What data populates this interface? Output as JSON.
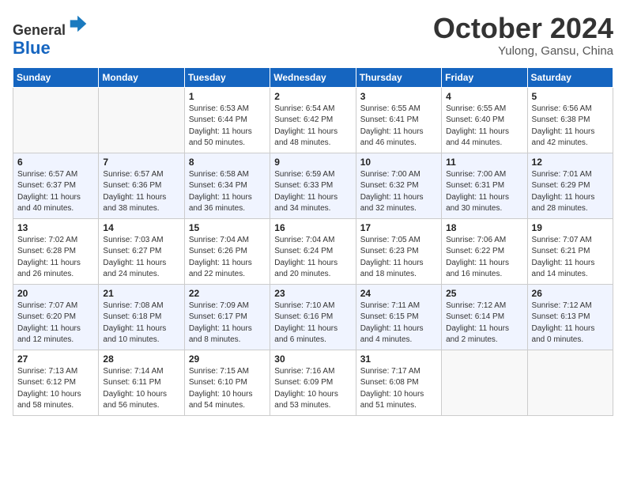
{
  "header": {
    "logo_line1": "General",
    "logo_line2": "Blue",
    "month": "October 2024",
    "location": "Yulong, Gansu, China"
  },
  "weekdays": [
    "Sunday",
    "Monday",
    "Tuesday",
    "Wednesday",
    "Thursday",
    "Friday",
    "Saturday"
  ],
  "weeks": [
    [
      {
        "day": "",
        "info": ""
      },
      {
        "day": "",
        "info": ""
      },
      {
        "day": "1",
        "info": "Sunrise: 6:53 AM\nSunset: 6:44 PM\nDaylight: 11 hours and 50 minutes."
      },
      {
        "day": "2",
        "info": "Sunrise: 6:54 AM\nSunset: 6:42 PM\nDaylight: 11 hours and 48 minutes."
      },
      {
        "day": "3",
        "info": "Sunrise: 6:55 AM\nSunset: 6:41 PM\nDaylight: 11 hours and 46 minutes."
      },
      {
        "day": "4",
        "info": "Sunrise: 6:55 AM\nSunset: 6:40 PM\nDaylight: 11 hours and 44 minutes."
      },
      {
        "day": "5",
        "info": "Sunrise: 6:56 AM\nSunset: 6:38 PM\nDaylight: 11 hours and 42 minutes."
      }
    ],
    [
      {
        "day": "6",
        "info": "Sunrise: 6:57 AM\nSunset: 6:37 PM\nDaylight: 11 hours and 40 minutes."
      },
      {
        "day": "7",
        "info": "Sunrise: 6:57 AM\nSunset: 6:36 PM\nDaylight: 11 hours and 38 minutes."
      },
      {
        "day": "8",
        "info": "Sunrise: 6:58 AM\nSunset: 6:34 PM\nDaylight: 11 hours and 36 minutes."
      },
      {
        "day": "9",
        "info": "Sunrise: 6:59 AM\nSunset: 6:33 PM\nDaylight: 11 hours and 34 minutes."
      },
      {
        "day": "10",
        "info": "Sunrise: 7:00 AM\nSunset: 6:32 PM\nDaylight: 11 hours and 32 minutes."
      },
      {
        "day": "11",
        "info": "Sunrise: 7:00 AM\nSunset: 6:31 PM\nDaylight: 11 hours and 30 minutes."
      },
      {
        "day": "12",
        "info": "Sunrise: 7:01 AM\nSunset: 6:29 PM\nDaylight: 11 hours and 28 minutes."
      }
    ],
    [
      {
        "day": "13",
        "info": "Sunrise: 7:02 AM\nSunset: 6:28 PM\nDaylight: 11 hours and 26 minutes."
      },
      {
        "day": "14",
        "info": "Sunrise: 7:03 AM\nSunset: 6:27 PM\nDaylight: 11 hours and 24 minutes."
      },
      {
        "day": "15",
        "info": "Sunrise: 7:04 AM\nSunset: 6:26 PM\nDaylight: 11 hours and 22 minutes."
      },
      {
        "day": "16",
        "info": "Sunrise: 7:04 AM\nSunset: 6:24 PM\nDaylight: 11 hours and 20 minutes."
      },
      {
        "day": "17",
        "info": "Sunrise: 7:05 AM\nSunset: 6:23 PM\nDaylight: 11 hours and 18 minutes."
      },
      {
        "day": "18",
        "info": "Sunrise: 7:06 AM\nSunset: 6:22 PM\nDaylight: 11 hours and 16 minutes."
      },
      {
        "day": "19",
        "info": "Sunrise: 7:07 AM\nSunset: 6:21 PM\nDaylight: 11 hours and 14 minutes."
      }
    ],
    [
      {
        "day": "20",
        "info": "Sunrise: 7:07 AM\nSunset: 6:20 PM\nDaylight: 11 hours and 12 minutes."
      },
      {
        "day": "21",
        "info": "Sunrise: 7:08 AM\nSunset: 6:18 PM\nDaylight: 11 hours and 10 minutes."
      },
      {
        "day": "22",
        "info": "Sunrise: 7:09 AM\nSunset: 6:17 PM\nDaylight: 11 hours and 8 minutes."
      },
      {
        "day": "23",
        "info": "Sunrise: 7:10 AM\nSunset: 6:16 PM\nDaylight: 11 hours and 6 minutes."
      },
      {
        "day": "24",
        "info": "Sunrise: 7:11 AM\nSunset: 6:15 PM\nDaylight: 11 hours and 4 minutes."
      },
      {
        "day": "25",
        "info": "Sunrise: 7:12 AM\nSunset: 6:14 PM\nDaylight: 11 hours and 2 minutes."
      },
      {
        "day": "26",
        "info": "Sunrise: 7:12 AM\nSunset: 6:13 PM\nDaylight: 11 hours and 0 minutes."
      }
    ],
    [
      {
        "day": "27",
        "info": "Sunrise: 7:13 AM\nSunset: 6:12 PM\nDaylight: 10 hours and 58 minutes."
      },
      {
        "day": "28",
        "info": "Sunrise: 7:14 AM\nSunset: 6:11 PM\nDaylight: 10 hours and 56 minutes."
      },
      {
        "day": "29",
        "info": "Sunrise: 7:15 AM\nSunset: 6:10 PM\nDaylight: 10 hours and 54 minutes."
      },
      {
        "day": "30",
        "info": "Sunrise: 7:16 AM\nSunset: 6:09 PM\nDaylight: 10 hours and 53 minutes."
      },
      {
        "day": "31",
        "info": "Sunrise: 7:17 AM\nSunset: 6:08 PM\nDaylight: 10 hours and 51 minutes."
      },
      {
        "day": "",
        "info": ""
      },
      {
        "day": "",
        "info": ""
      }
    ]
  ]
}
